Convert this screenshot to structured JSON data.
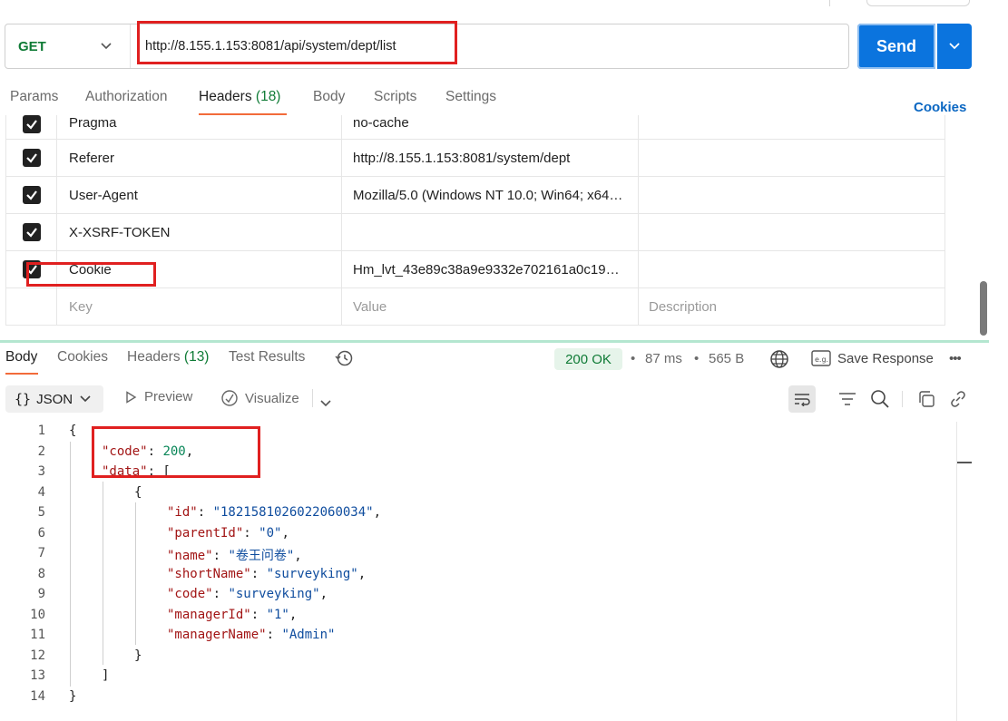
{
  "request": {
    "method": "GET",
    "url": "http://8.155.1.153:8081/api/system/dept/list",
    "send_label": "Send"
  },
  "request_tabs": [
    {
      "label": "Params",
      "count": ""
    },
    {
      "label": "Authorization",
      "count": ""
    },
    {
      "label": "Headers",
      "count": "(18)"
    },
    {
      "label": "Body",
      "count": ""
    },
    {
      "label": "Scripts",
      "count": ""
    },
    {
      "label": "Settings",
      "count": ""
    }
  ],
  "cookies_link": "Cookies",
  "headers": [
    {
      "key": "Pragma",
      "value": "no-cache",
      "checked": true
    },
    {
      "key": "Referer",
      "value": "http://8.155.1.153:8081/system/dept",
      "checked": true
    },
    {
      "key": "User-Agent",
      "value": "Mozilla/5.0 (Windows NT 10.0; Win64; x64…",
      "checked": true
    },
    {
      "key": "X-XSRF-TOKEN",
      "value": "",
      "checked": true
    },
    {
      "key": "Cookie",
      "value": "Hm_lvt_43e89c38a9e9332e702161a0c19…",
      "checked": true
    }
  ],
  "headers_placeholder": {
    "key": "Key",
    "value": "Value",
    "description": "Description"
  },
  "response_tabs": [
    {
      "label": "Body",
      "count": ""
    },
    {
      "label": "Cookies",
      "count": ""
    },
    {
      "label": "Headers",
      "count": "(13)"
    },
    {
      "label": "Test Results",
      "count": ""
    }
  ],
  "response_meta": {
    "status": "200 OK",
    "time": "87 ms",
    "size": "565 B",
    "save_response": "Save Response"
  },
  "response_toolbar": {
    "format": "JSON",
    "preview": "Preview",
    "visualize": "Visualize"
  },
  "code_lines": [
    {
      "n": "1",
      "tokens": [
        [
          "p",
          "{"
        ]
      ]
    },
    {
      "n": "2",
      "tokens": [
        [
          "k",
          "\"code\""
        ],
        [
          "p",
          ": "
        ],
        [
          "n",
          "200"
        ],
        [
          "p",
          ","
        ]
      ]
    },
    {
      "n": "3",
      "tokens": [
        [
          "k",
          "\"data\""
        ],
        [
          "p",
          ": ["
        ]
      ]
    },
    {
      "n": "4",
      "tokens": [
        [
          "p",
          "{"
        ]
      ]
    },
    {
      "n": "5",
      "tokens": [
        [
          "k",
          "\"id\""
        ],
        [
          "p",
          ": "
        ],
        [
          "s",
          "\"1821581026022060034\""
        ],
        [
          "p",
          ","
        ]
      ]
    },
    {
      "n": "6",
      "tokens": [
        [
          "k",
          "\"parentId\""
        ],
        [
          "p",
          ": "
        ],
        [
          "s",
          "\"0\""
        ],
        [
          "p",
          ","
        ]
      ]
    },
    {
      "n": "7",
      "tokens": [
        [
          "k",
          "\"name\""
        ],
        [
          "p",
          ": "
        ],
        [
          "s",
          "\"卷王问卷\""
        ],
        [
          "p",
          ","
        ]
      ]
    },
    {
      "n": "8",
      "tokens": [
        [
          "k",
          "\"shortName\""
        ],
        [
          "p",
          ": "
        ],
        [
          "s",
          "\"surveyking\""
        ],
        [
          "p",
          ","
        ]
      ]
    },
    {
      "n": "9",
      "tokens": [
        [
          "k",
          "\"code\""
        ],
        [
          "p",
          ": "
        ],
        [
          "s",
          "\"surveyking\""
        ],
        [
          "p",
          ","
        ]
      ]
    },
    {
      "n": "10",
      "tokens": [
        [
          "k",
          "\"managerId\""
        ],
        [
          "p",
          ": "
        ],
        [
          "s",
          "\"1\""
        ],
        [
          "p",
          ","
        ]
      ]
    },
    {
      "n": "11",
      "tokens": [
        [
          "k",
          "\"managerName\""
        ],
        [
          "p",
          ": "
        ],
        [
          "s",
          "\"Admin\""
        ]
      ]
    },
    {
      "n": "12",
      "tokens": [
        [
          "p",
          "}"
        ]
      ]
    },
    {
      "n": "13",
      "tokens": [
        [
          "p",
          "]"
        ]
      ]
    },
    {
      "n": "14",
      "tokens": [
        [
          "p",
          "}"
        ]
      ]
    }
  ],
  "colors": {
    "accent": "#0b74de",
    "tab_underline": "#f26b3a",
    "status_green": "#0f7b36",
    "annotation_red": "#e02020"
  }
}
